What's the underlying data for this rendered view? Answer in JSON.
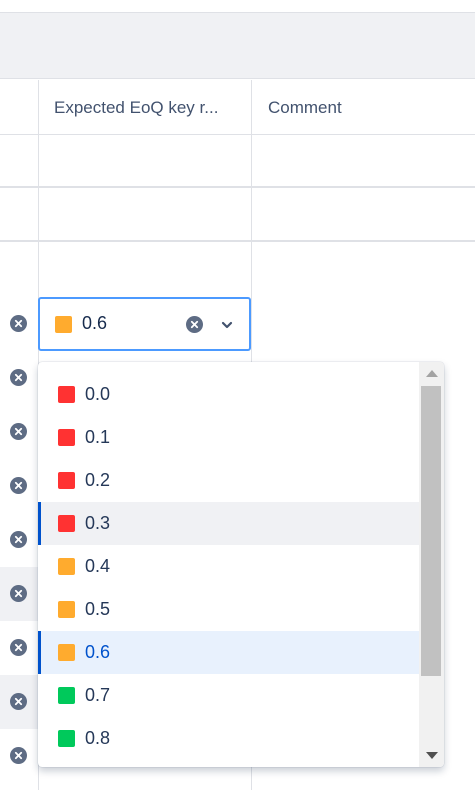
{
  "table": {
    "columns": [
      {
        "label": "Expected EoQ key r..."
      },
      {
        "label": "Comment"
      }
    ]
  },
  "select": {
    "value": "0.6",
    "value_color": "#ffab2e",
    "clear_icon": "clear-icon",
    "chevron_icon": "chevron-down-icon"
  },
  "dropdown": {
    "options": [
      {
        "label": "0.0",
        "color": "#ff3232"
      },
      {
        "label": "0.1",
        "color": "#ff3232"
      },
      {
        "label": "0.2",
        "color": "#ff3232"
      },
      {
        "label": "0.3",
        "color": "#ff3232",
        "state": "hovered"
      },
      {
        "label": "0.4",
        "color": "#ffab2e"
      },
      {
        "label": "0.5",
        "color": "#ffab2e"
      },
      {
        "label": "0.6",
        "color": "#ffab2e",
        "state": "selected"
      },
      {
        "label": "0.7",
        "color": "#00c95b"
      },
      {
        "label": "0.8",
        "color": "#00c95b"
      }
    ]
  },
  "colors": {
    "accent": "#0052cc",
    "focus_border": "#4c9aff",
    "red": "#ff3232",
    "orange": "#ffab2e",
    "green": "#00c95b"
  }
}
